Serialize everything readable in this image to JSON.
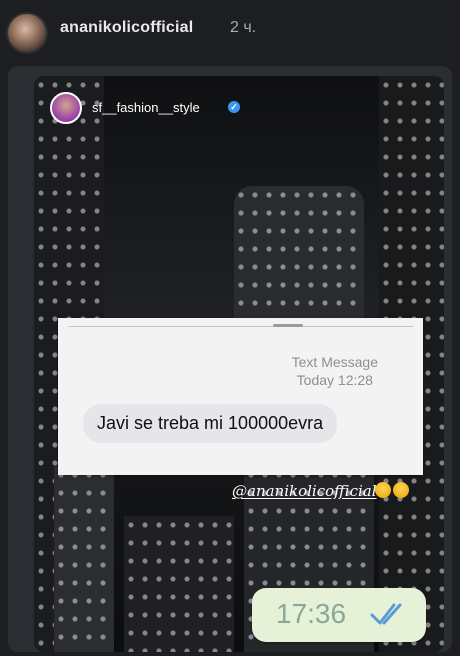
{
  "header": {
    "username": "ananikolicofficial",
    "time_ago": "2 ч."
  },
  "story": {
    "sticker_username": "sf__fashion__style",
    "verified_icon": "verified-badge-icon",
    "message_card": {
      "title": "Text Message",
      "timestamp": "Today 12:28",
      "text": "Javi se treba mi 100000evra"
    },
    "mention": "@ananikolicofficial",
    "emoji_icons": [
      "grinning-sweat-emoji-icon",
      "grinning-sweat-emoji-icon"
    ],
    "chat_time": "17:36",
    "read_receipt_icon": "double-check-icon"
  },
  "colors": {
    "background": "#1c1e21",
    "bubble_gray": "#e5e5ea",
    "time_bubble": "#e6f2d7",
    "read_tick": "#5a9bd6"
  }
}
